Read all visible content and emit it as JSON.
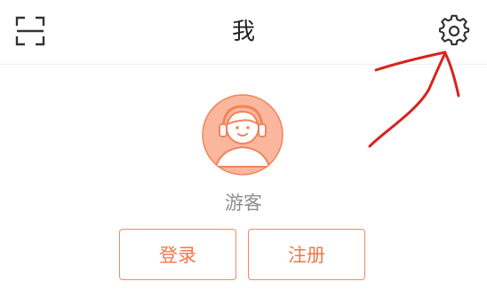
{
  "header": {
    "title": "我",
    "scan_icon": "scan-icon",
    "settings_icon": "gear-icon"
  },
  "profile": {
    "avatar_icon": "guest-avatar-headphones",
    "username": "游客"
  },
  "actions": {
    "login_label": "登录",
    "register_label": "注册"
  },
  "colors": {
    "accent": "#f0764a",
    "avatar_bg": "#fbb79d",
    "annotation": "#d9231d"
  }
}
